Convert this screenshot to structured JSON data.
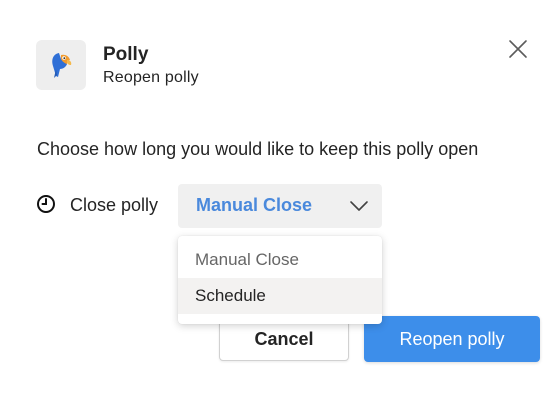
{
  "header": {
    "app_name": "Polly",
    "subtitle": "Reopen polly",
    "app_icon": "polly-parrot-icon",
    "close_icon": "close-icon"
  },
  "body": {
    "instruction": "Choose how long you would like to keep this polly open",
    "close_label": "Close polly",
    "clock_icon": "clock-icon"
  },
  "dropdown": {
    "selected_value": "Manual Close",
    "chevron_icon": "chevron-down-icon",
    "options": [
      "Manual Close",
      "Schedule"
    ],
    "hovered_option": "Schedule"
  },
  "footer": {
    "cancel_label": "Cancel",
    "primary_label": "Reopen polly"
  },
  "colors": {
    "accent_text": "#4a89dc",
    "primary_button": "#3d8eea",
    "dropdown_bg": "#f0f0f0",
    "icon_tile_bg": "#eeeeee",
    "parrot_blue": "#2f6fd6",
    "parrot_orange": "#f29b2e"
  }
}
